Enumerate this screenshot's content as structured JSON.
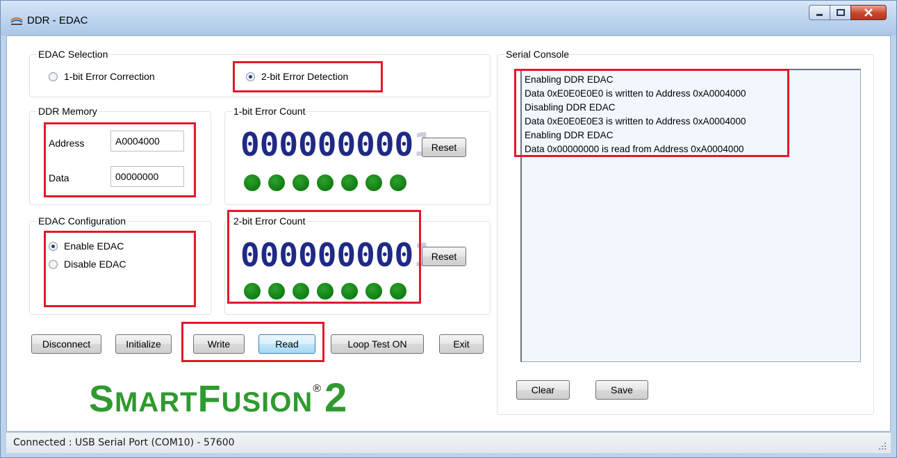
{
  "window": {
    "title": "DDR - EDAC",
    "minimize_icon": "minimize-icon",
    "maximize_icon": "maximize-icon",
    "close_icon": "close-icon"
  },
  "edac_selection": {
    "title": "EDAC Selection",
    "options": [
      {
        "label": "1-bit Error Correction",
        "checked": false
      },
      {
        "label": "2-bit Error Detection",
        "checked": true
      }
    ]
  },
  "ddr_memory": {
    "title": "DDR Memory",
    "address_label": "Address",
    "address_value": "A0004000",
    "data_label": "Data",
    "data_value": "00000000"
  },
  "one_bit_count": {
    "title": "1-bit Error Count",
    "value": "000000000",
    "ghost_digit": "1",
    "reset_label": "Reset",
    "led_count": 7
  },
  "edac_config": {
    "title": "EDAC Configuration",
    "options": [
      {
        "label": "Enable EDAC",
        "checked": true
      },
      {
        "label": "Disable EDAC",
        "checked": false
      }
    ]
  },
  "two_bit_count": {
    "title": "2-bit Error Count",
    "value": "000000000",
    "ghost_digit": "1",
    "reset_label": "Reset",
    "led_count": 7
  },
  "buttons": {
    "disconnect": "Disconnect",
    "initialize": "Initialize",
    "write": "Write",
    "read": "Read",
    "loop_test": "Loop Test ON",
    "exit": "Exit"
  },
  "logo": {
    "part1_big": "S",
    "part1_small": "MART",
    "part2_big": "F",
    "part2_small": "USION",
    "reg": "®",
    "number": "2"
  },
  "serial_console": {
    "title": "Serial Console",
    "lines": [
      "Enabling  DDR EDAC",
      "Data 0xE0E0E0E0 is written to Address 0xA0004000",
      "Disabling DDR EDAC",
      "Data 0xE0E0E0E3 is written to Address 0xA0004000",
      "Enabling  DDR EDAC",
      "Data 0x00000000 is read from Address 0xA0004000"
    ],
    "clear_label": "Clear",
    "save_label": "Save"
  },
  "status_bar": {
    "text": "Connected : USB Serial Port (COM10) - 57600"
  },
  "colors": {
    "highlight": "#e0192a",
    "led": "#117c11",
    "digits": "#1f2a86",
    "logo": "#2f9a2f"
  }
}
